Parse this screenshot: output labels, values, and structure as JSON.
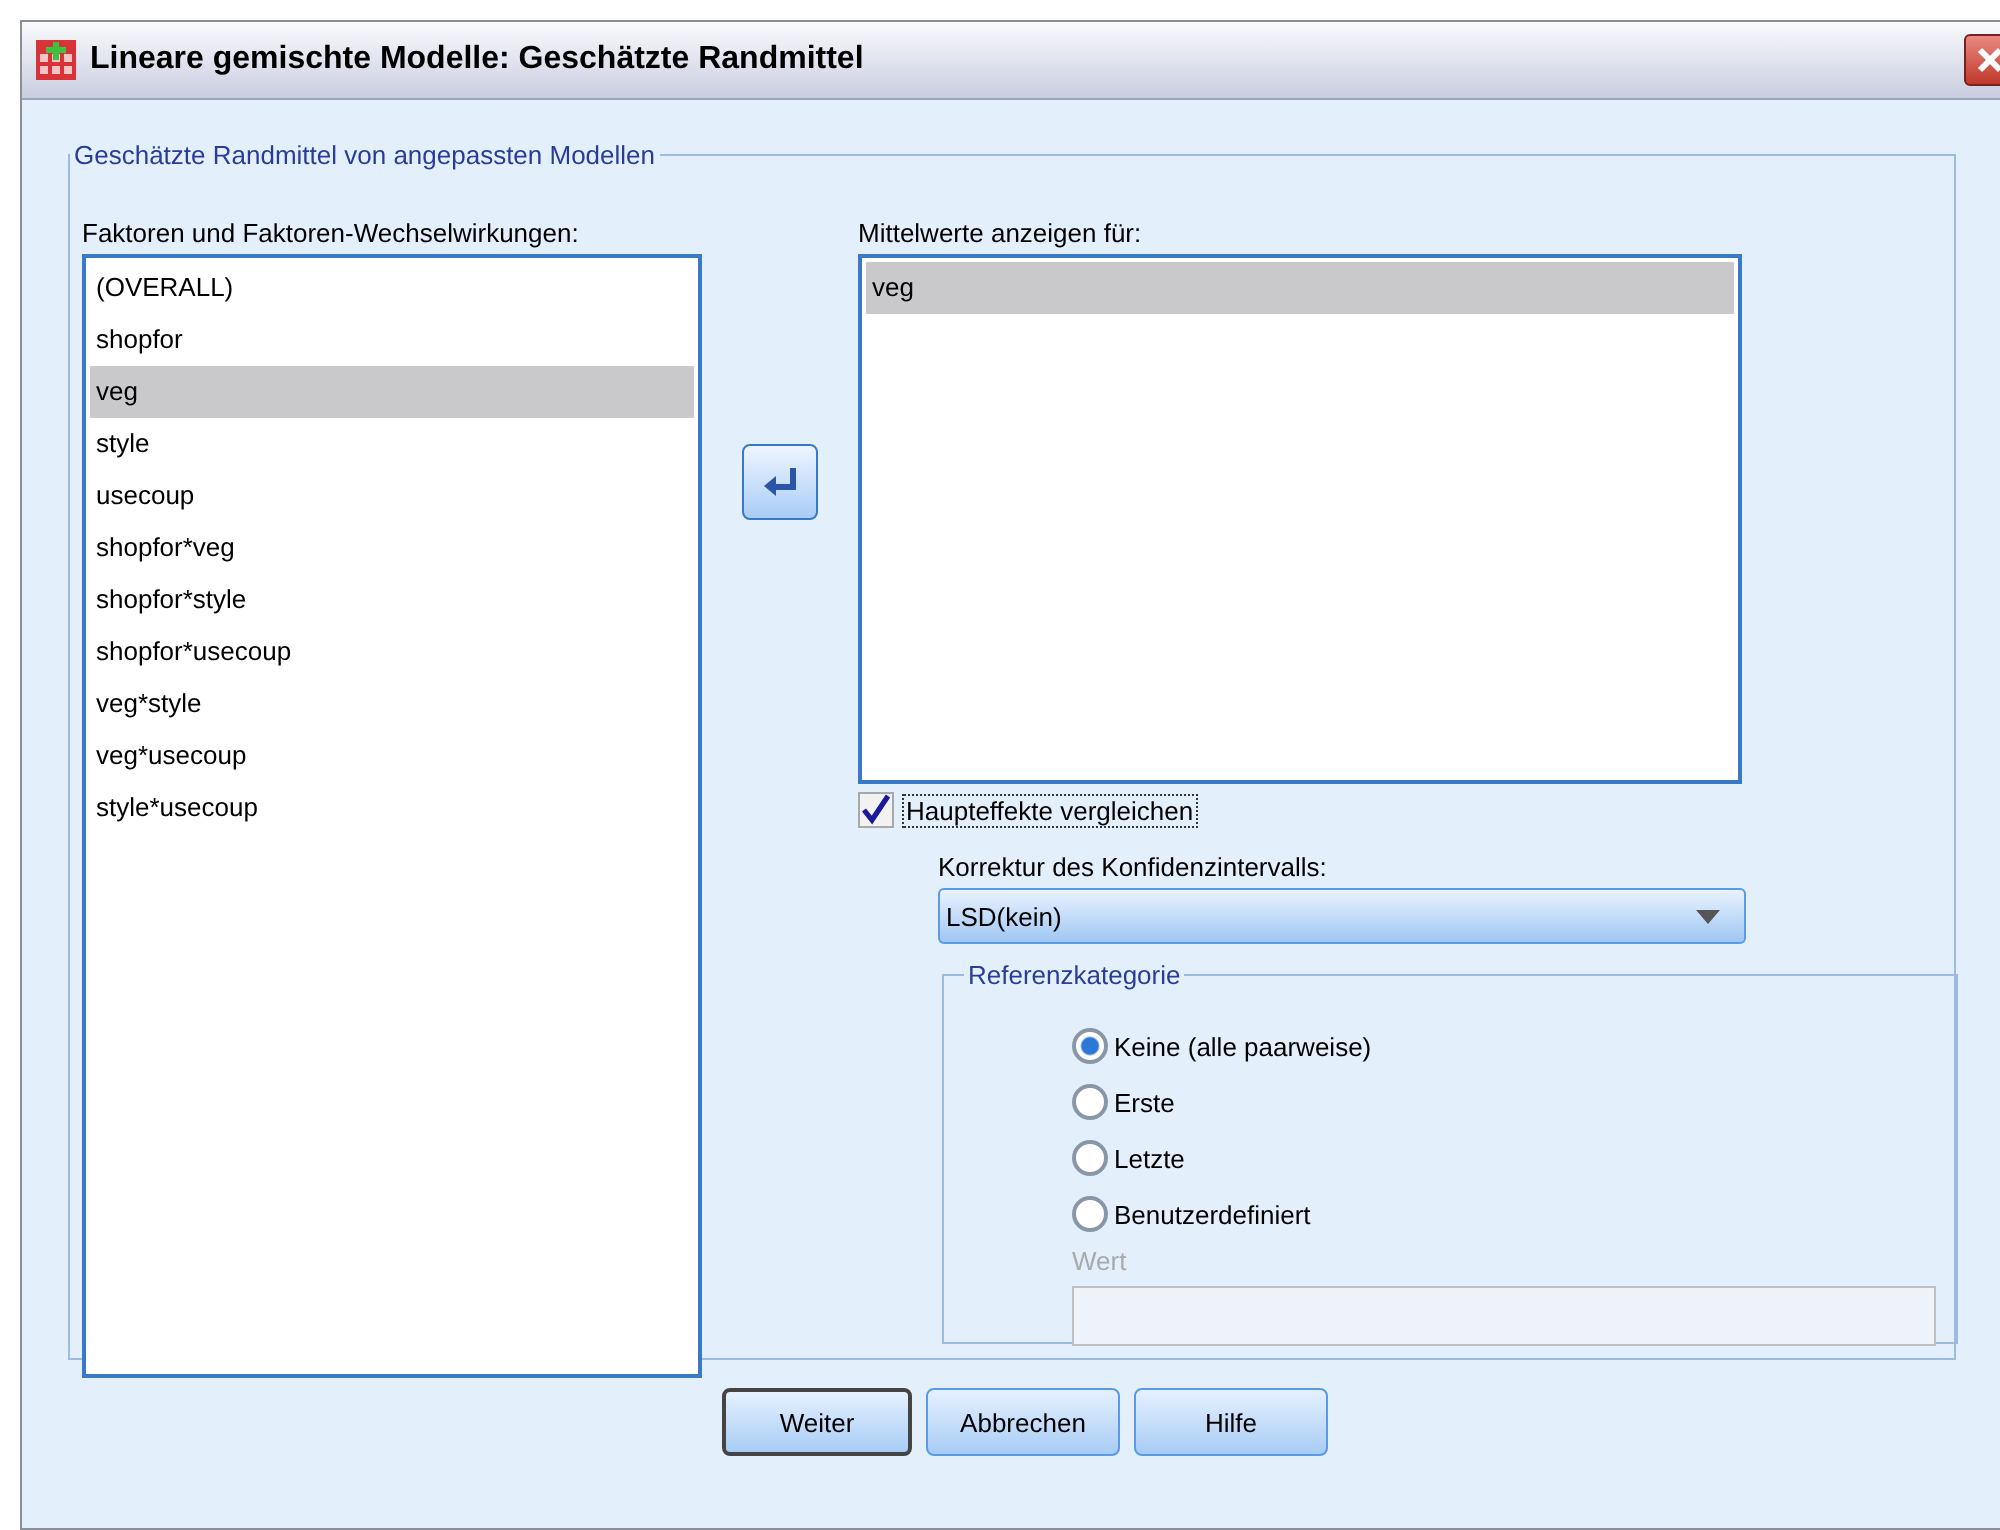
{
  "window": {
    "title": "Lineare gemischte Modelle: Geschätzte Randmittel"
  },
  "group": {
    "title": "Geschätzte Randmittel von angepassten Modellen"
  },
  "factors": {
    "label": "Faktoren und Faktoren-Wechselwirkungen:",
    "items": [
      {
        "text": "(OVERALL)",
        "selected": false
      },
      {
        "text": "shopfor",
        "selected": false
      },
      {
        "text": "veg",
        "selected": true
      },
      {
        "text": "style",
        "selected": false
      },
      {
        "text": "usecoup",
        "selected": false
      },
      {
        "text": "shopfor*veg",
        "selected": false
      },
      {
        "text": "shopfor*style",
        "selected": false
      },
      {
        "text": "shopfor*usecoup",
        "selected": false
      },
      {
        "text": "veg*style",
        "selected": false
      },
      {
        "text": "veg*usecoup",
        "selected": false
      },
      {
        "text": "style*usecoup",
        "selected": false
      }
    ]
  },
  "display_means": {
    "label": "Mittelwerte anzeigen für:",
    "items": [
      {
        "text": "veg",
        "selected": true
      }
    ]
  },
  "compare": {
    "label": "Haupteffekte vergleichen",
    "checked": true
  },
  "correction": {
    "label": "Korrektur des Konfidenzintervalls:",
    "value": "LSD(kein)"
  },
  "reference": {
    "title": "Referenzkategorie",
    "options": [
      {
        "label": "Keine (alle paarweise)",
        "selected": true
      },
      {
        "label": "Erste",
        "selected": false
      },
      {
        "label": "Letzte",
        "selected": false
      },
      {
        "label": "Benutzerdefiniert",
        "selected": false
      }
    ],
    "value_label": "Wert",
    "value_disabled": true
  },
  "buttons": [
    {
      "label": "Weiter",
      "default": true
    },
    {
      "label": "Abbrechen",
      "default": false
    },
    {
      "label": "Hilfe",
      "default": false
    }
  ]
}
